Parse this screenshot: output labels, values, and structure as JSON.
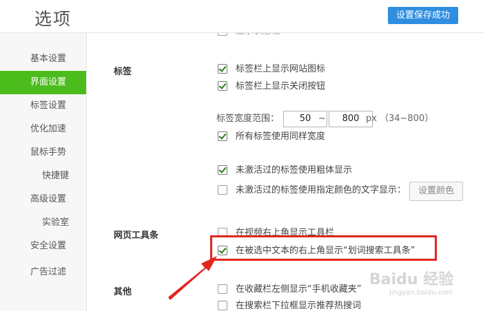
{
  "header": {
    "title": "选项",
    "save_status": "设置保存成功"
  },
  "sidebar": {
    "items": [
      {
        "label": "基本设置"
      },
      {
        "label": "界面设置"
      },
      {
        "label": "标签设置"
      },
      {
        "label": "优化加速"
      },
      {
        "label": "鼠标手势"
      },
      {
        "label": "快捷键"
      },
      {
        "label": "高级设置"
      },
      {
        "label": "实验室"
      },
      {
        "label": "安全设置"
      },
      {
        "label": "广告过滤"
      }
    ]
  },
  "content": {
    "cut_top_option": "显示状态栏",
    "tabs_section": {
      "label": "标签",
      "options": [
        {
          "label": "标签栏上显示网站图标",
          "checked": true
        },
        {
          "label": "标签栏上显示关闭按钮",
          "checked": true
        }
      ],
      "width_label": "标签宽度范围：",
      "min_width": "50",
      "tilde": "~",
      "max_width": "800",
      "unit": "px",
      "range_hint": "（34~800）",
      "same_width": {
        "label": "所有标签使用同样宽度",
        "checked": true
      },
      "bold_inactive": {
        "label": "未激活过的标签使用粗体显示",
        "checked": true
      },
      "color_inactive": {
        "label": "未激活过的标签使用指定颜色的文字显示：",
        "checked": false
      },
      "color_button": "设置颜色"
    },
    "toolbar_section": {
      "label": "网页工具条",
      "options": [
        {
          "label": "在视频右上角显示工具栏",
          "checked": false
        },
        {
          "label": "在被选中文本的右上角显示“划词搜索工具条”",
          "checked": true
        }
      ]
    },
    "other_section": {
      "label": "其他",
      "options": [
        {
          "label": "在收藏栏左侧显示“手机收藏夹”",
          "checked": false
        },
        {
          "label": "在搜索栏下拉框显示推荐热搜词",
          "checked": false
        }
      ]
    }
  },
  "watermark": {
    "text": "Baidu 经验",
    "sub": "jingyan.baidu.com"
  }
}
